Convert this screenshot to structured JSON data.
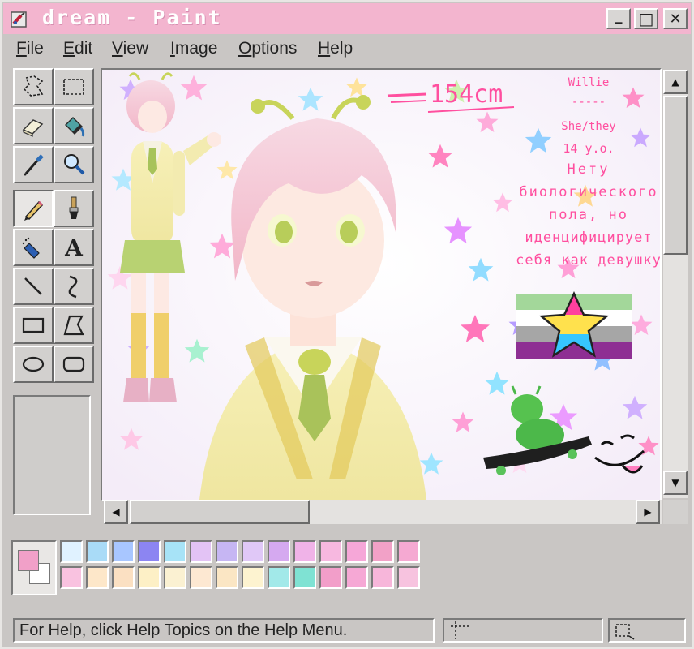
{
  "window": {
    "title": "dream - Paint",
    "controls": {
      "minimize": "_",
      "maximize": "□",
      "close": "✕"
    }
  },
  "menu": {
    "items": [
      {
        "accel": "F",
        "rest": "ile"
      },
      {
        "accel": "E",
        "rest": "dit"
      },
      {
        "accel": "V",
        "rest": "iew"
      },
      {
        "accel": "I",
        "rest": "mage"
      },
      {
        "accel": "O",
        "rest": "ptions"
      },
      {
        "accel": "H",
        "rest": "elp"
      }
    ]
  },
  "toolbox": {
    "tools": [
      "free-form-select-icon",
      "select-icon",
      "eraser-icon",
      "fill-icon",
      "color-picker-icon",
      "magnifier-icon",
      "pencil-icon",
      "brush-icon",
      "airbrush-icon",
      "text-icon",
      "line-icon",
      "curve-icon",
      "rectangle-icon",
      "polygon-icon",
      "ellipse-icon",
      "rounded-rectangle-icon"
    ],
    "selected_index": 6,
    "text_tool_label": "A"
  },
  "artwork": {
    "height_label": "154cm",
    "info_lines": [
      "Willie",
      "-----",
      "She/they",
      "14 y.o.",
      "Нету",
      "биологического",
      "пола, но",
      "иденцифицирует",
      "себя как девушку"
    ],
    "flag_colors": [
      "#a3d79a",
      "#ffffff",
      "#a6a6a6",
      "#8e2f93"
    ],
    "star_colors": [
      "#ff3f9e",
      "#ffe14d",
      "#36c7ff"
    ]
  },
  "palette": {
    "primary_color": "#f1a0c8",
    "secondary_color": "#ffffff",
    "row1": [
      "#e0f2ff",
      "#a9dbf7",
      "#a8c6ff",
      "#8c85f2",
      "#a7e3f7",
      "#e3c3f5",
      "#c6b6f3",
      "#e0c8f7",
      "#d5a9f0",
      "#f0b3e8",
      "#f7b8e0",
      "#f6a7d8",
      "#f2a1c7",
      "#f5a9d2"
    ],
    "row2": [
      "#f9c2e0",
      "#fde7c9",
      "#fbe0c2",
      "#fdf0c6",
      "#fbf1d2",
      "#fde8d2",
      "#fbe6c4",
      "#fdf3d0",
      "#a2e9e9",
      "#7fe2d3",
      "#f29ec9",
      "#f6a8d5",
      "#f7b6da",
      "#f7c3df"
    ]
  },
  "status": {
    "help_text": "For Help, click Help Topics on the Help Menu."
  }
}
